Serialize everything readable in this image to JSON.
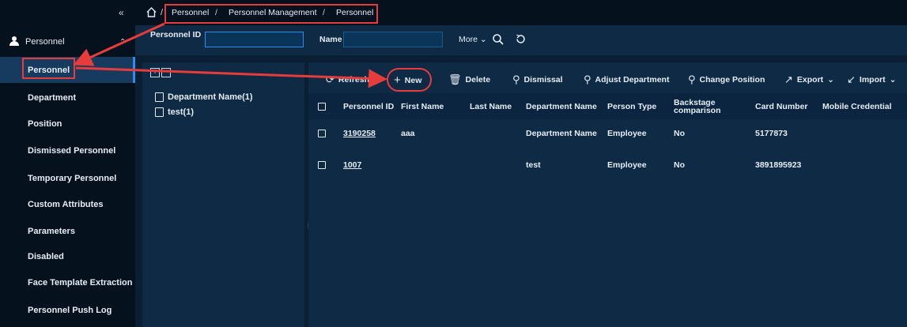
{
  "sidebar": {
    "collapse_icon": "«",
    "module": {
      "icon": "person-icon",
      "label": "Personnel",
      "caret": "^"
    },
    "items": [
      {
        "label": "Personnel",
        "active": true
      },
      {
        "label": "Department"
      },
      {
        "label": "Position"
      },
      {
        "label": "Dismissed Personnel"
      },
      {
        "label": "Temporary Personnel"
      },
      {
        "label": "Custom Attributes"
      },
      {
        "label": "Parameters"
      },
      {
        "label": "Disabled"
      },
      {
        "label": "Face Template Extraction"
      },
      {
        "label": "Personnel Push Log"
      }
    ]
  },
  "breadcrumb": {
    "home_icon": "home-icon",
    "items": [
      "Personnel",
      "Personnel Management",
      "Personnel"
    ],
    "separator": "/"
  },
  "filter": {
    "personnel_id_label": "Personnel ID",
    "personnel_id_value": "",
    "name_label": "Name",
    "name_value": "",
    "more_label": "More",
    "search_icon": "search-icon",
    "reset_icon": "refresh-icon"
  },
  "tree": {
    "expand_icon": "+",
    "collapse_icon": "−",
    "items": [
      "Department Name(1)",
      "test(1)"
    ]
  },
  "toolbar": {
    "refresh": "Refresh",
    "new": "New",
    "delete": "Delete",
    "dismissal": "Dismissal",
    "adjust_department": "Adjust Department",
    "change_position": "Change Position",
    "export": "Export",
    "import": "Import"
  },
  "table": {
    "columns": [
      "Personnel ID",
      "First Name",
      "Last Name",
      "Department Name",
      "Person Type",
      "Backstage comparison",
      "Card Number",
      "Mobile Credential"
    ],
    "rows": [
      [
        "3190258",
        "aaa",
        "",
        "Department Name",
        "Employee",
        "No",
        "5177873",
        ""
      ],
      [
        "1007",
        "",
        "",
        "test",
        "Employee",
        "No",
        "3891895923",
        ""
      ]
    ]
  },
  "colors": {
    "accent": "#2d8cf0",
    "annotation": "#e63c3c",
    "sidebar_bg": "#06111e",
    "panel_bg": "#0e2a44"
  }
}
